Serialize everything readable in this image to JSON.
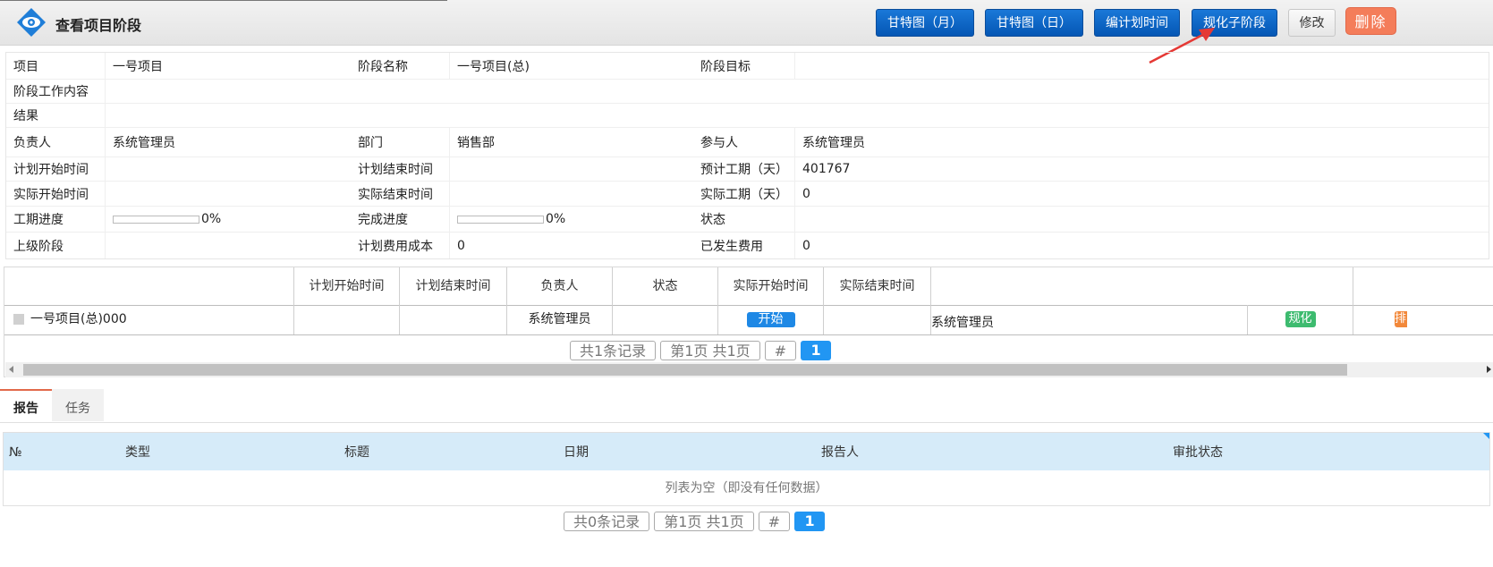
{
  "header": {
    "title": "查看项目阶段",
    "buttons": {
      "gantt_month": "甘特图（月）",
      "gantt_day": "甘特图（日）",
      "edit_plan_time": "编计划时间",
      "standardize_child": "规化子阶段",
      "modify": "修改",
      "delete": "删除"
    }
  },
  "info": {
    "project_label": "项目",
    "project_value": "一号项目",
    "stage_name_label": "阶段名称",
    "stage_name_value": "一号项目(总)",
    "stage_goal_label": "阶段目标",
    "stage_goal_value": "",
    "work_content_label": "阶段工作内容",
    "work_content_value": "",
    "result_label": "结果",
    "result_value": "",
    "owner_label": "负责人",
    "owner_value": "系统管理员",
    "dept_label": "部门",
    "dept_value": "销售部",
    "participant_label": "参与人",
    "participant_value": "系统管理员",
    "plan_start_label": "计划开始时间",
    "plan_start_value": "",
    "plan_end_label": "计划结束时间",
    "plan_end_value": "",
    "est_duration_label": "预计工期（天）",
    "est_duration_value": "401767",
    "actual_start_label": "实际开始时间",
    "actual_start_value": "",
    "actual_end_label": "实际结束时间",
    "actual_end_value": "",
    "actual_duration_label": "实际工期（天）",
    "actual_duration_value": "0",
    "schedule_progress_label": "工期进度",
    "schedule_progress_value": "0%",
    "schedule_progress_fraction": 0,
    "completion_label": "完成进度",
    "completion_value": "0%",
    "completion_fraction": 0,
    "status_label": "状态",
    "status_value": "",
    "parent_stage_label": "上级阶段",
    "parent_stage_value": "",
    "plan_cost_label": "计划费用成本",
    "plan_cost_value": "0",
    "incurred_cost_label": "已发生费用",
    "incurred_cost_value": "0"
  },
  "stage_grid": {
    "columns": [
      "计划开始时间",
      "计划结束时间",
      "负责人",
      "状态",
      "实际开始时间",
      "实际结束时间"
    ],
    "row": {
      "name": "一号项目(总)000",
      "plan_start": "",
      "plan_end": "",
      "owner": "系统管理员",
      "status": "",
      "start_button": "开始",
      "actual_end": "",
      "participant": "系统管理员",
      "tag_standardize": "规化",
      "tag_partial": "排"
    },
    "pager": {
      "records": "共1条记录",
      "pages": "第1页 共1页",
      "hash": "#",
      "current": "1"
    }
  },
  "tabs": [
    "报告",
    "任务"
  ],
  "report_table": {
    "columns": [
      "№",
      "类型",
      "标题",
      "日期",
      "报告人",
      "审批状态"
    ],
    "empty_text": "列表为空（即没有任何数据）",
    "pager": {
      "records": "共0条记录",
      "pages": "第1页 共1页",
      "hash": "#",
      "current": "1"
    }
  },
  "colors": {
    "primary_button": "#0a66cc",
    "delete_button": "#f47d5a",
    "start_button": "#1e88e5",
    "tag_green": "#3dbb6f",
    "tag_orange": "#f2883a",
    "table_header": "#d6ebf9",
    "annotation_arrow": "#e53935"
  }
}
